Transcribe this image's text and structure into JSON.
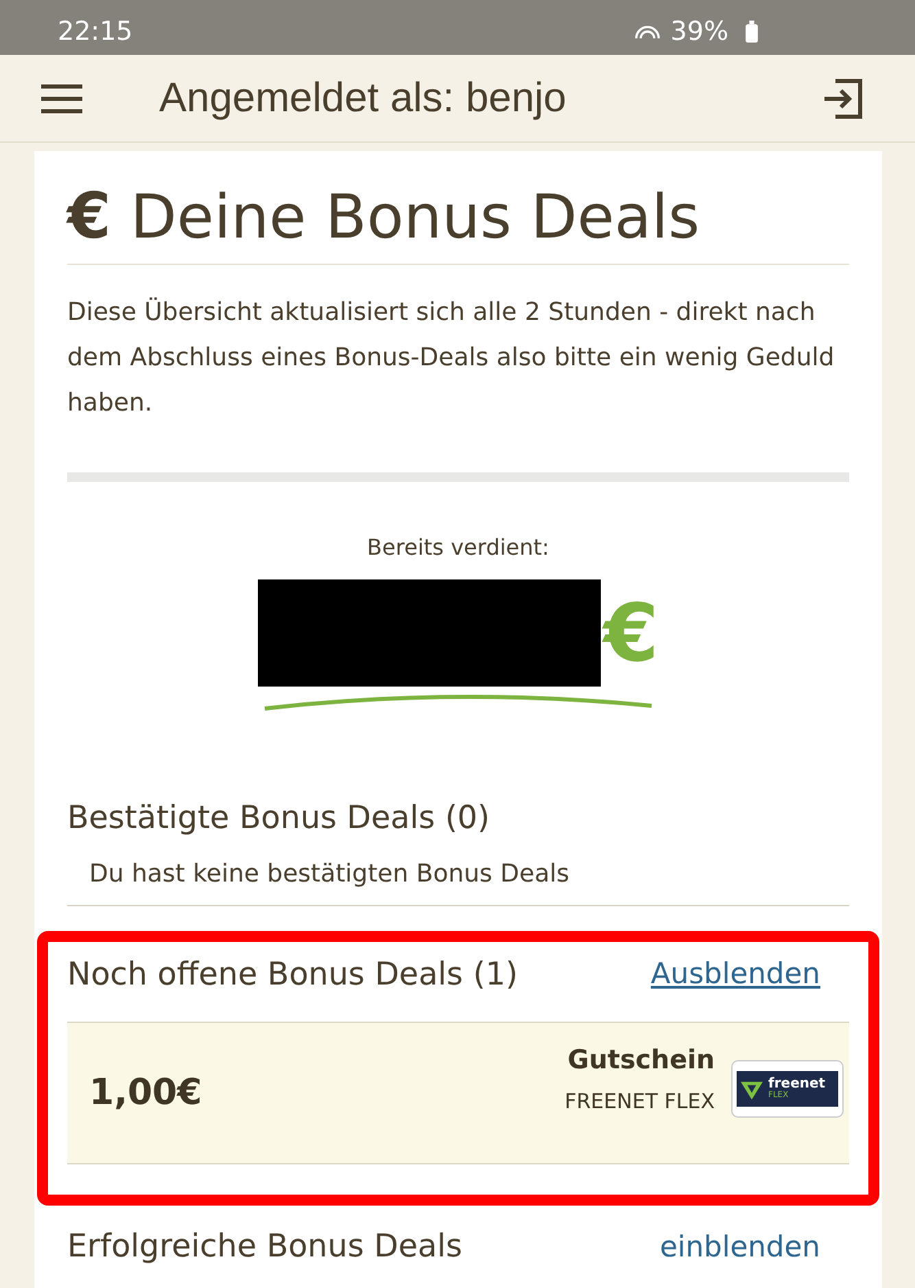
{
  "status_bar": {
    "time": "22:15",
    "battery": "39%"
  },
  "app_bar": {
    "title": "Angemeldet als: benjo"
  },
  "page": {
    "currency_symbol": "€",
    "title": "Deine Bonus Deals",
    "intro": "Diese Übersicht aktualisiert sich alle 2 Stunden - direkt nach dem Abschluss eines Bonus-Deals also bitte ein wenig Geduld haben.",
    "earned_label": "Bereits verdient:",
    "earned_currency": "€"
  },
  "sections": [
    {
      "kind": "list",
      "title": "Bestätigte Bonus Deals (0)",
      "empty_text": "Du hast keine bestätigten Bonus Deals",
      "highlighted": false
    },
    {
      "kind": "list",
      "title": "Noch offene Bonus Deals (1)",
      "toggle": "Ausblenden",
      "highlighted": true,
      "deals": [
        {
          "amount": "1,00€",
          "type": "Gutschein",
          "partner": "FREENET FLEX",
          "logo_text": "freenet",
          "logo_subtext": "FLEX"
        }
      ]
    },
    {
      "kind": "list",
      "title": "Erfolgreiche Bonus Deals",
      "toggle": "einblenden",
      "highlighted": false
    }
  ]
}
